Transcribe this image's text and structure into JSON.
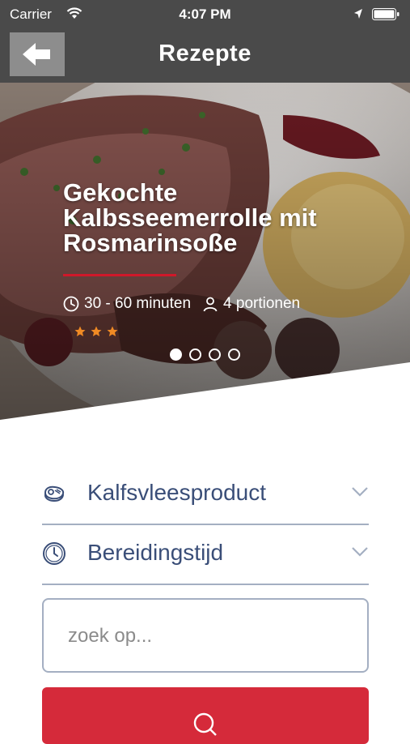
{
  "status_bar": {
    "carrier": "Carrier",
    "time": "4:07 PM"
  },
  "nav": {
    "title": "Rezepte",
    "back_icon": "arrow-left-icon"
  },
  "hero": {
    "title_lines": [
      "Gekochte",
      "Kalbsseemerrolle mit",
      "Rosmarinsoße"
    ],
    "duration": "30 - 60 minuten",
    "portions": "4 portionen",
    "rating": 3,
    "rating_max": 3,
    "slides": 4,
    "active_slide": 1,
    "accent_color": "#d0182a",
    "star_color": "#f08a24"
  },
  "filters": [
    {
      "label": "Kalfsvleesproduct",
      "icon": "meat-icon"
    },
    {
      "label": "Bereidingstijd",
      "icon": "clock-icon"
    }
  ],
  "search": {
    "placeholder": "zoek op..."
  },
  "colors": {
    "nav_bg": "#4a4a4a",
    "text_blue": "#3a4e78",
    "button_red": "#d52a3a"
  }
}
